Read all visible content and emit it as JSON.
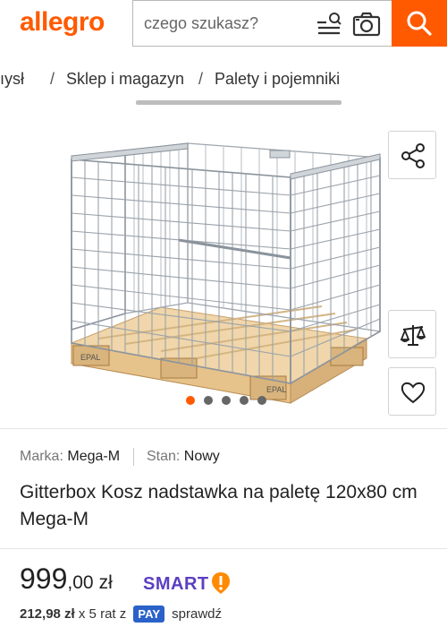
{
  "header": {
    "logo": "allegro",
    "search_placeholder": "czego szukasz?"
  },
  "breadcrumb": {
    "items": [
      "ıysł",
      "Sklep i magazyn",
      "Palety i pojemniki"
    ],
    "separator": "/"
  },
  "gallery": {
    "image_count": 5,
    "active_index": 0
  },
  "product": {
    "brand_label": "Marka:",
    "brand_value": "Mega-M",
    "condition_label": "Stan:",
    "condition_value": "Nowy",
    "title": "Gitterbox Kosz nadstawka na paletę 120x80 cm Mega-M"
  },
  "price": {
    "integer": "999",
    "decimal": ",00",
    "currency": "zł",
    "smart_label": "SMART"
  },
  "installment": {
    "amount": "212,98 zł",
    "text": "x 5 rat z",
    "pay_label": "PAY",
    "check": "sprawdź"
  },
  "colors": {
    "brand": "#ff5a00",
    "smart": "#5a3fc0",
    "pay": "#2b62c9"
  },
  "icons": [
    "search-icon",
    "filter-icon",
    "camera-icon",
    "share-icon",
    "compare-icon",
    "heart-icon",
    "smart-badge-icon"
  ]
}
